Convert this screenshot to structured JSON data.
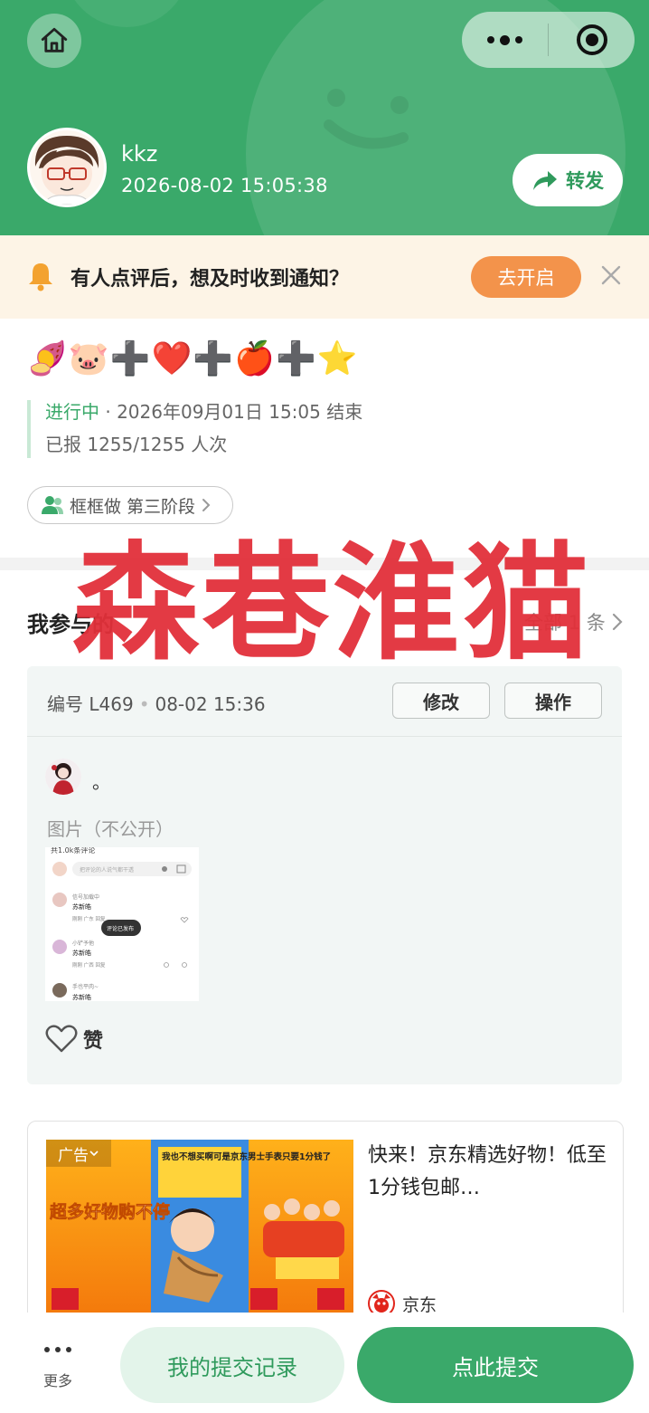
{
  "header": {
    "username": "kkz",
    "timestamp": "2026-08-02 15:05:38",
    "forward_label": "转发"
  },
  "notice": {
    "text": "有人点评后，想及时收到通知？",
    "enable_label": "去开启"
  },
  "activity": {
    "title_emoji": "🍠🐷➕❤️➕🍎➕⭐",
    "status": "进行中",
    "end_text": "· 2026年09月01日 15:05 结束",
    "reported": "已报 1255/1255 人次",
    "group_tag": "框框做 第三阶段"
  },
  "watermark": "森巷淮猫",
  "my_participation": {
    "title": "我参与的",
    "all_label": "全部 1 条"
  },
  "entry": {
    "id_label": "编号 L469",
    "time": "08-02 15:36",
    "edit_label": "修改",
    "operate_label": "操作",
    "text": "。",
    "image_label": "图片（不公开）",
    "like_label": "赞",
    "thumb": {
      "header": "共1.0k条评论",
      "input_placeholder": "把评论的人说气都干透",
      "c1_name": "信号加载中",
      "c1_text": "苏新皓",
      "c1_meta": "刚刚 广东 回复",
      "toast": "评论已发布",
      "c2_name": "小铲予他",
      "c2_text": "苏新皓",
      "c2_meta": "刚刚 广西 回复",
      "c3_name": "手也平肉~",
      "c3_text": "苏新皓"
    }
  },
  "ad": {
    "tag": "广告",
    "title": "快来！京东精选好物！低至1分钱包邮…",
    "brand": "京东",
    "img_slogan": "超多好物购不停",
    "img_banner": "我也不想买啊可是京东男士手表只要1分钱了"
  },
  "bottom": {
    "more_label": "更多",
    "record_label": "我的提交记录",
    "submit_label": "点此提交"
  },
  "colors": {
    "brand_green": "#3aa96a",
    "notice_bg": "#fdf4e6",
    "enable_orange": "#f3934b",
    "watermark_red": "#e2303a"
  }
}
